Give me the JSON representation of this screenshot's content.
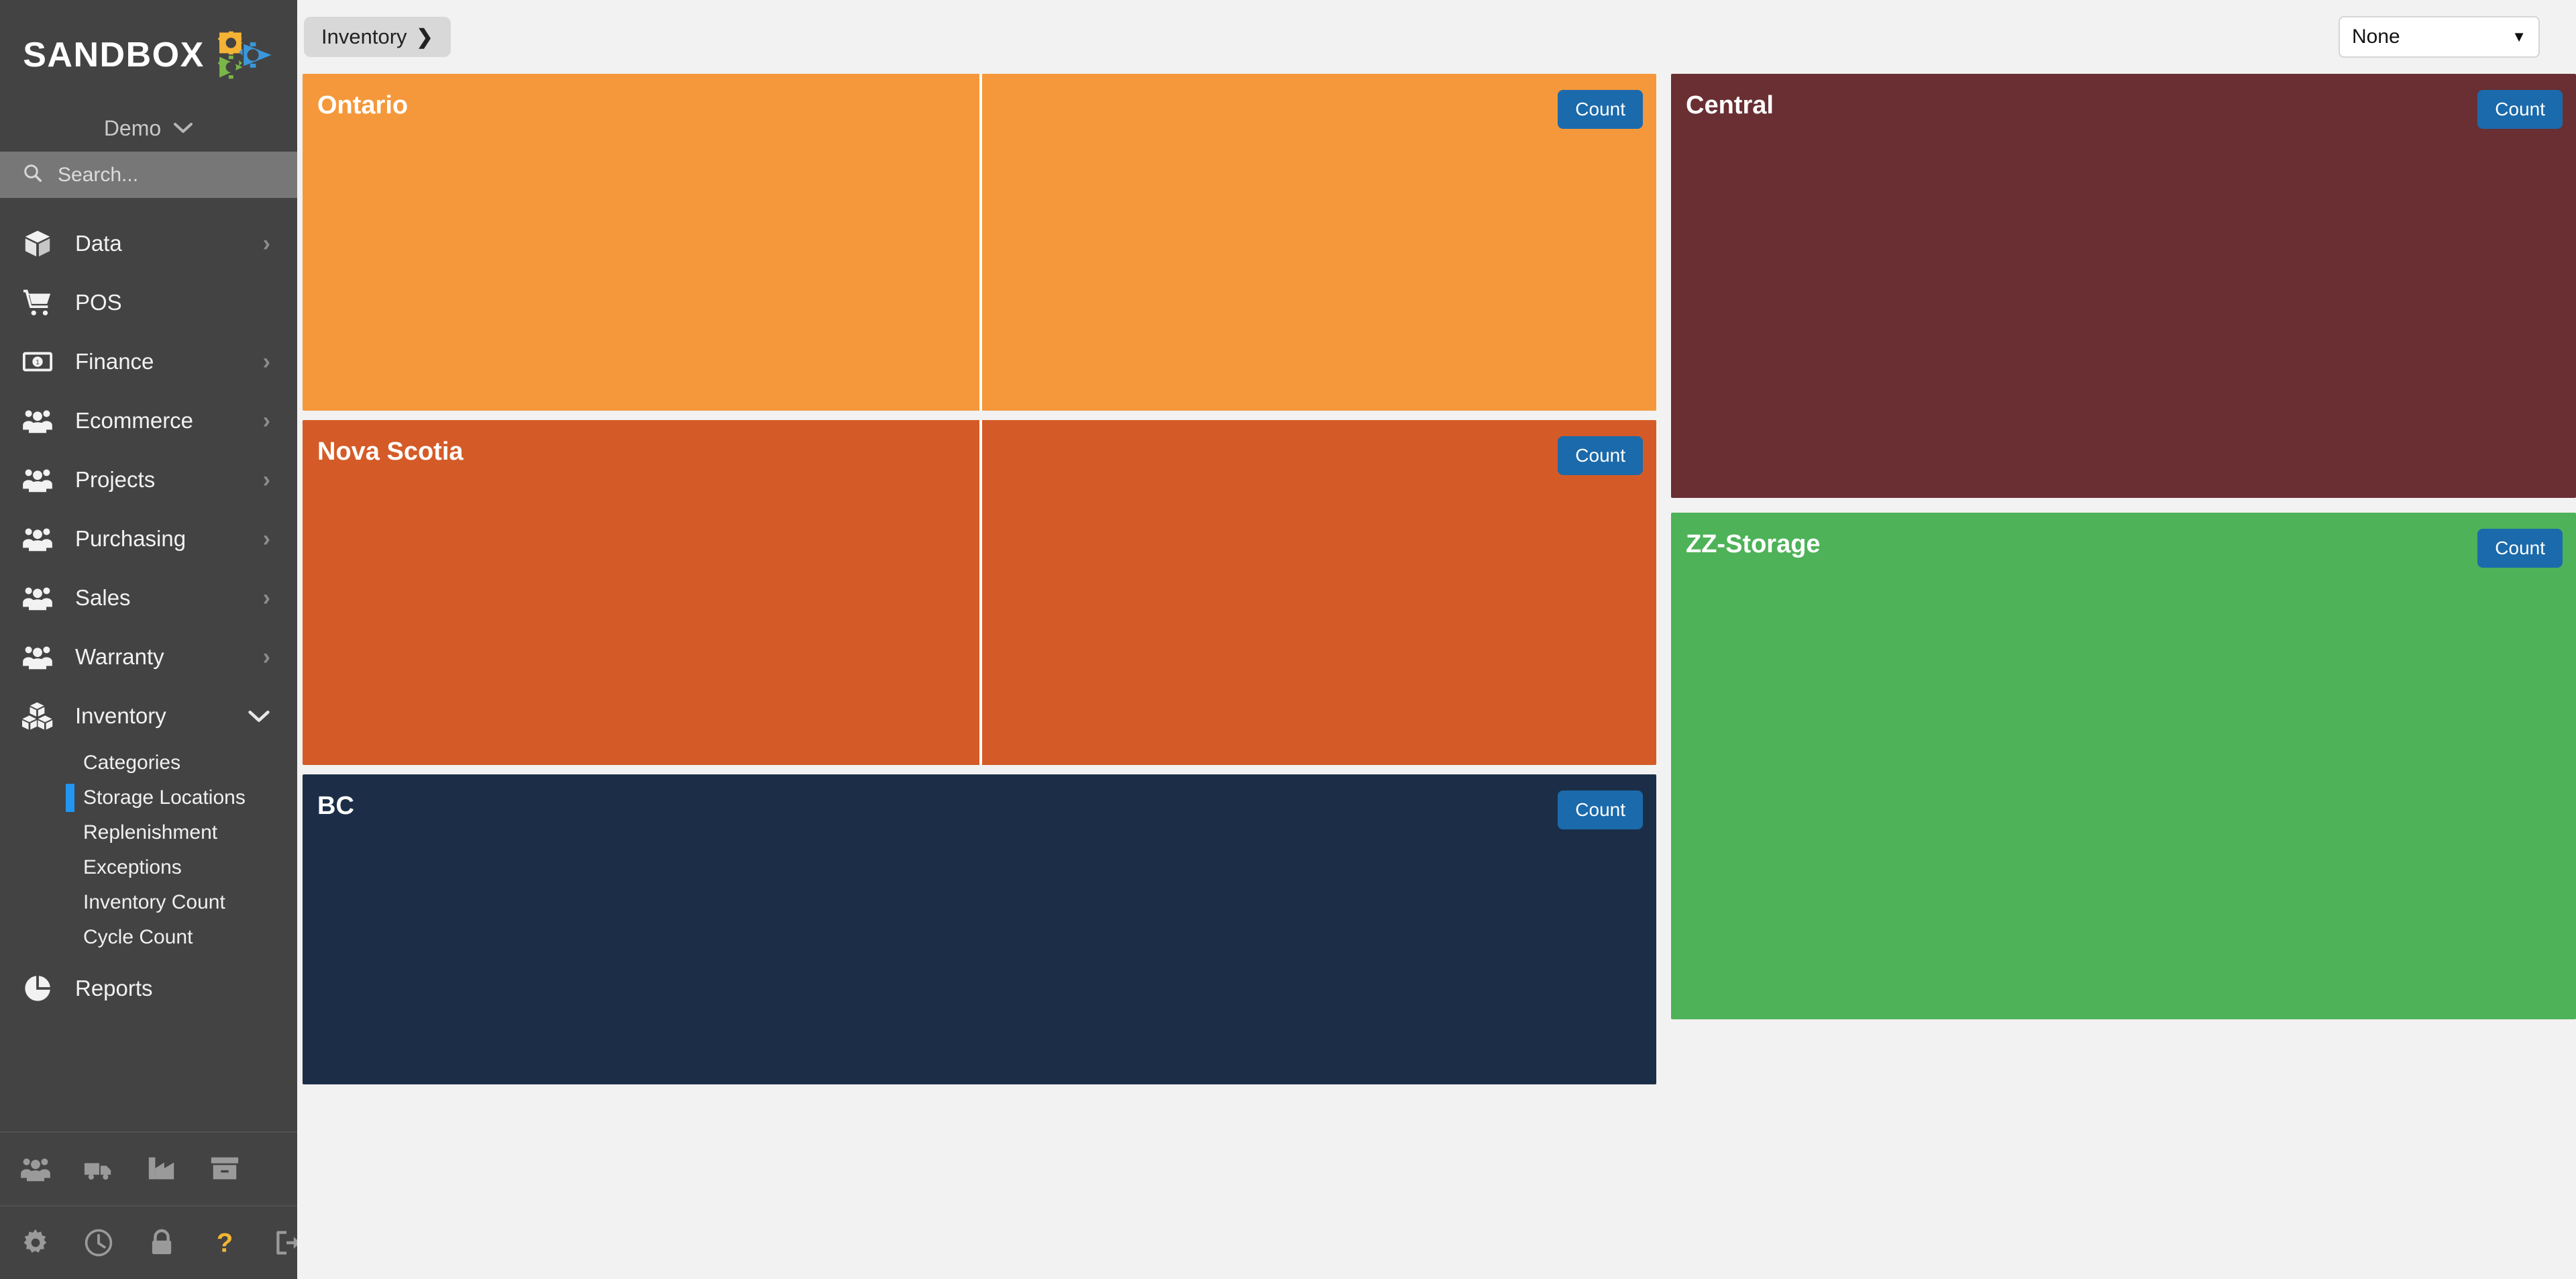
{
  "brand": {
    "name": "SANDBOX",
    "logo_icon": "sandbox-gears-logo",
    "logo_colors": {
      "yellow": "#f5b335",
      "blue": "#3a97d9",
      "green": "#7ab648"
    }
  },
  "tenant": {
    "label": "Demo",
    "chevron_icon": "chevron-down-icon"
  },
  "search": {
    "placeholder": "Search...",
    "value": "",
    "icon": "search-icon"
  },
  "sidebar": {
    "background": "#434343",
    "active_marker_color": "#2196f3",
    "items": [
      {
        "label": "Data",
        "icon": "box-icon",
        "expandable": true,
        "arrow": "›"
      },
      {
        "label": "POS",
        "icon": "cart-icon",
        "expandable": false,
        "arrow": ""
      },
      {
        "label": "Finance",
        "icon": "banknote-icon",
        "expandable": true,
        "arrow": "›"
      },
      {
        "label": "Ecommerce",
        "icon": "people-icon",
        "expandable": true,
        "arrow": "›"
      },
      {
        "label": "Projects",
        "icon": "people-icon",
        "expandable": true,
        "arrow": "›"
      },
      {
        "label": "Purchasing",
        "icon": "people-icon",
        "expandable": true,
        "arrow": "›"
      },
      {
        "label": "Sales",
        "icon": "people-icon",
        "expandable": true,
        "arrow": "›"
      },
      {
        "label": "Warranty",
        "icon": "people-icon",
        "expandable": true,
        "arrow": "›"
      },
      {
        "label": "Inventory",
        "icon": "boxes-icon",
        "expandable": true,
        "arrow": "⌄",
        "expanded": true
      }
    ],
    "inventory_subitems": [
      {
        "label": "Categories",
        "active": false
      },
      {
        "label": "Storage Locations",
        "active": true
      },
      {
        "label": "Replenishment",
        "active": false
      },
      {
        "label": "Exceptions",
        "active": false
      },
      {
        "label": "Inventory Count",
        "active": false
      },
      {
        "label": "Cycle Count",
        "active": false
      }
    ],
    "reports": {
      "label": "Reports",
      "icon": "pie-chart-icon"
    },
    "tools_row1": [
      {
        "icon": "people-icon"
      },
      {
        "icon": "truck-icon"
      },
      {
        "icon": "factory-icon"
      },
      {
        "icon": "archive-box-icon"
      }
    ],
    "tools_row2": [
      {
        "icon": "gear-icon"
      },
      {
        "icon": "clock-icon"
      },
      {
        "icon": "lock-icon"
      },
      {
        "icon": "question-mark-icon",
        "color": "#f2b632"
      },
      {
        "icon": "logout-icon"
      }
    ]
  },
  "topbar": {
    "breadcrumb": {
      "label": "Inventory",
      "chevron": "❯"
    },
    "filter_select": {
      "value": "None",
      "caret": "▼"
    }
  },
  "board": {
    "count_label": "Count",
    "left_column": [
      {
        "title": "Ontario",
        "color": "#f5983b",
        "split_at_pct": 50
      },
      {
        "title": "Nova Scotia",
        "color": "#d45b27",
        "split_at_pct": 50
      },
      {
        "title": "BC",
        "color": "#1c2e47",
        "split_at_pct": null
      }
    ],
    "right_column": [
      {
        "title": "Central",
        "color": "#692f33",
        "split_at_pct": null
      },
      {
        "title": "ZZ-Storage",
        "color": "#4eb258",
        "split_at_pct": null
      }
    ]
  }
}
